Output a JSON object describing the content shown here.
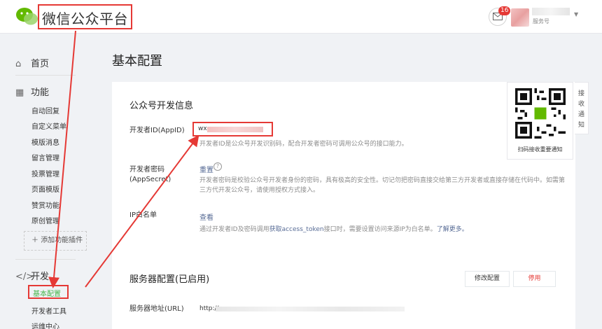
{
  "header": {
    "title": "微信公众平台",
    "badge_count": "16",
    "account_type": "服务号"
  },
  "sidebar": {
    "home": "首页",
    "functions": "功能",
    "function_items": [
      "自动回复",
      "自定义菜单",
      "模版消息",
      "留言管理",
      "投票管理",
      "页面模版",
      "赞赏功能",
      "原创管理"
    ],
    "add_plugin": "添加功能插件",
    "develop": "开发",
    "develop_items": [
      "基本配置",
      "开发者工具",
      "运维中心"
    ]
  },
  "page": {
    "title": "基本配置"
  },
  "dev_info": {
    "section_title": "公众号开发信息",
    "appid_label": "开发者ID(AppID)",
    "appid_prefix": "wx",
    "appid_desc": "开发者ID是公众号开发识别码，配合开发者密码可调用公众号的接口能力。",
    "secret_label_1": "开发者密码",
    "secret_label_2": "(AppSecret)",
    "secret_action": "重置",
    "secret_desc_1": "开发者密码是校验公众号开发者身份的密码，具有极高的安全性。切记勿把密码直接交给第三方开发者或直接存储在代码中。如需第",
    "secret_desc_2": "三方代开发公众号，请使用授权方式接入。",
    "ip_label": "IP白名单",
    "ip_action": "查看",
    "ip_desc_before": "通过开发者ID及密码调用",
    "ip_desc_link1": "获取access_token",
    "ip_desc_middle": "接口时，需要设置访问来源IP为白名单。",
    "ip_desc_link2": "了解更多。"
  },
  "server": {
    "section_title": "服务器配置(已启用)",
    "modify_button": "修改配置",
    "disable_button": "停用",
    "url_label": "服务器地址(URL)",
    "url_prefix": "http://"
  },
  "qr_popup": {
    "caption": "扫码接收重要通知",
    "tab_label": "接收通知"
  },
  "colors": {
    "accent_green": "#44b549",
    "link_blue": "#576b95",
    "annotation_red": "#e53935",
    "danger_red": "#e53935"
  }
}
